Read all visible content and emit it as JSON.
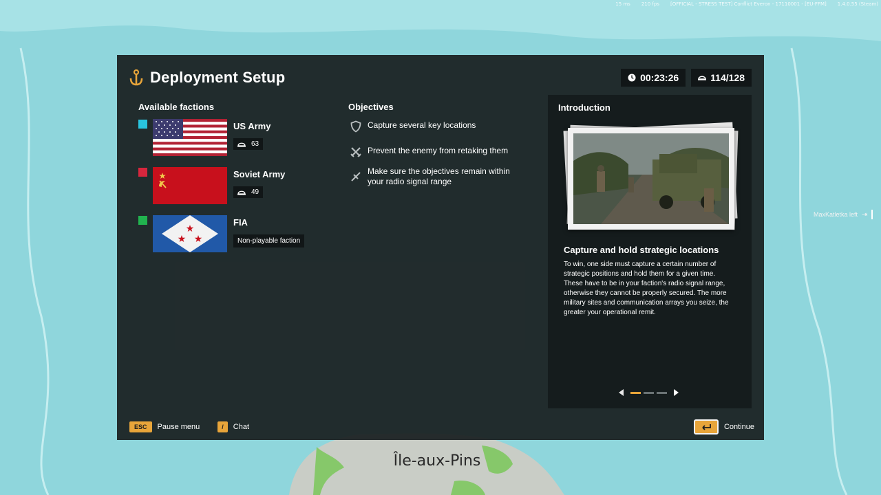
{
  "status_bar": {
    "ping": "15 ms",
    "fps": "210 fps",
    "server": "[OFFICIAL - STRESS TEST] Conflict Everon - 17110001 - [EU-FFM]",
    "version": "1.4.0.55 (Steam)"
  },
  "side_note": "MaxKatletka left",
  "map_label": "Île-aux-Pins",
  "header": {
    "title": "Deployment Setup",
    "timer": "00:23:26",
    "players": "114/128"
  },
  "factions": {
    "title": "Available factions",
    "items": [
      {
        "name": "US Army",
        "count": "63",
        "color": "#29c4de"
      },
      {
        "name": "Soviet Army",
        "count": "49",
        "color": "#d7263d"
      },
      {
        "name": "FIA",
        "note": "Non-playable faction",
        "color": "#21b34f"
      }
    ]
  },
  "objectives": {
    "title": "Objectives",
    "items": [
      {
        "icon": "shield-icon",
        "text": "Capture several key locations"
      },
      {
        "icon": "crossed-swords-icon",
        "text": "Prevent the enemy from retaking them"
      },
      {
        "icon": "radio-signal-icon",
        "text": "Make sure the objectives remain within your radio signal range"
      }
    ]
  },
  "introduction": {
    "title": "Introduction",
    "headline": "Capture and hold strategic locations",
    "body": "To win, one side must capture a certain number of strategic positions and hold them for a given time. These have to be in your faction's radio signal range, otherwise they cannot be properly secured. The more military sites and communication arrays you seize, the greater your operational remit.",
    "page": 1,
    "pages": 3
  },
  "footer": {
    "pause_key": "ESC",
    "pause_label": "Pause menu",
    "chat_key": "/",
    "chat_label": "Chat",
    "continue_label": "Continue"
  },
  "colors": {
    "accent": "#e8a53a",
    "panel": "#1b2122",
    "map_water": "#8fd6dc"
  }
}
